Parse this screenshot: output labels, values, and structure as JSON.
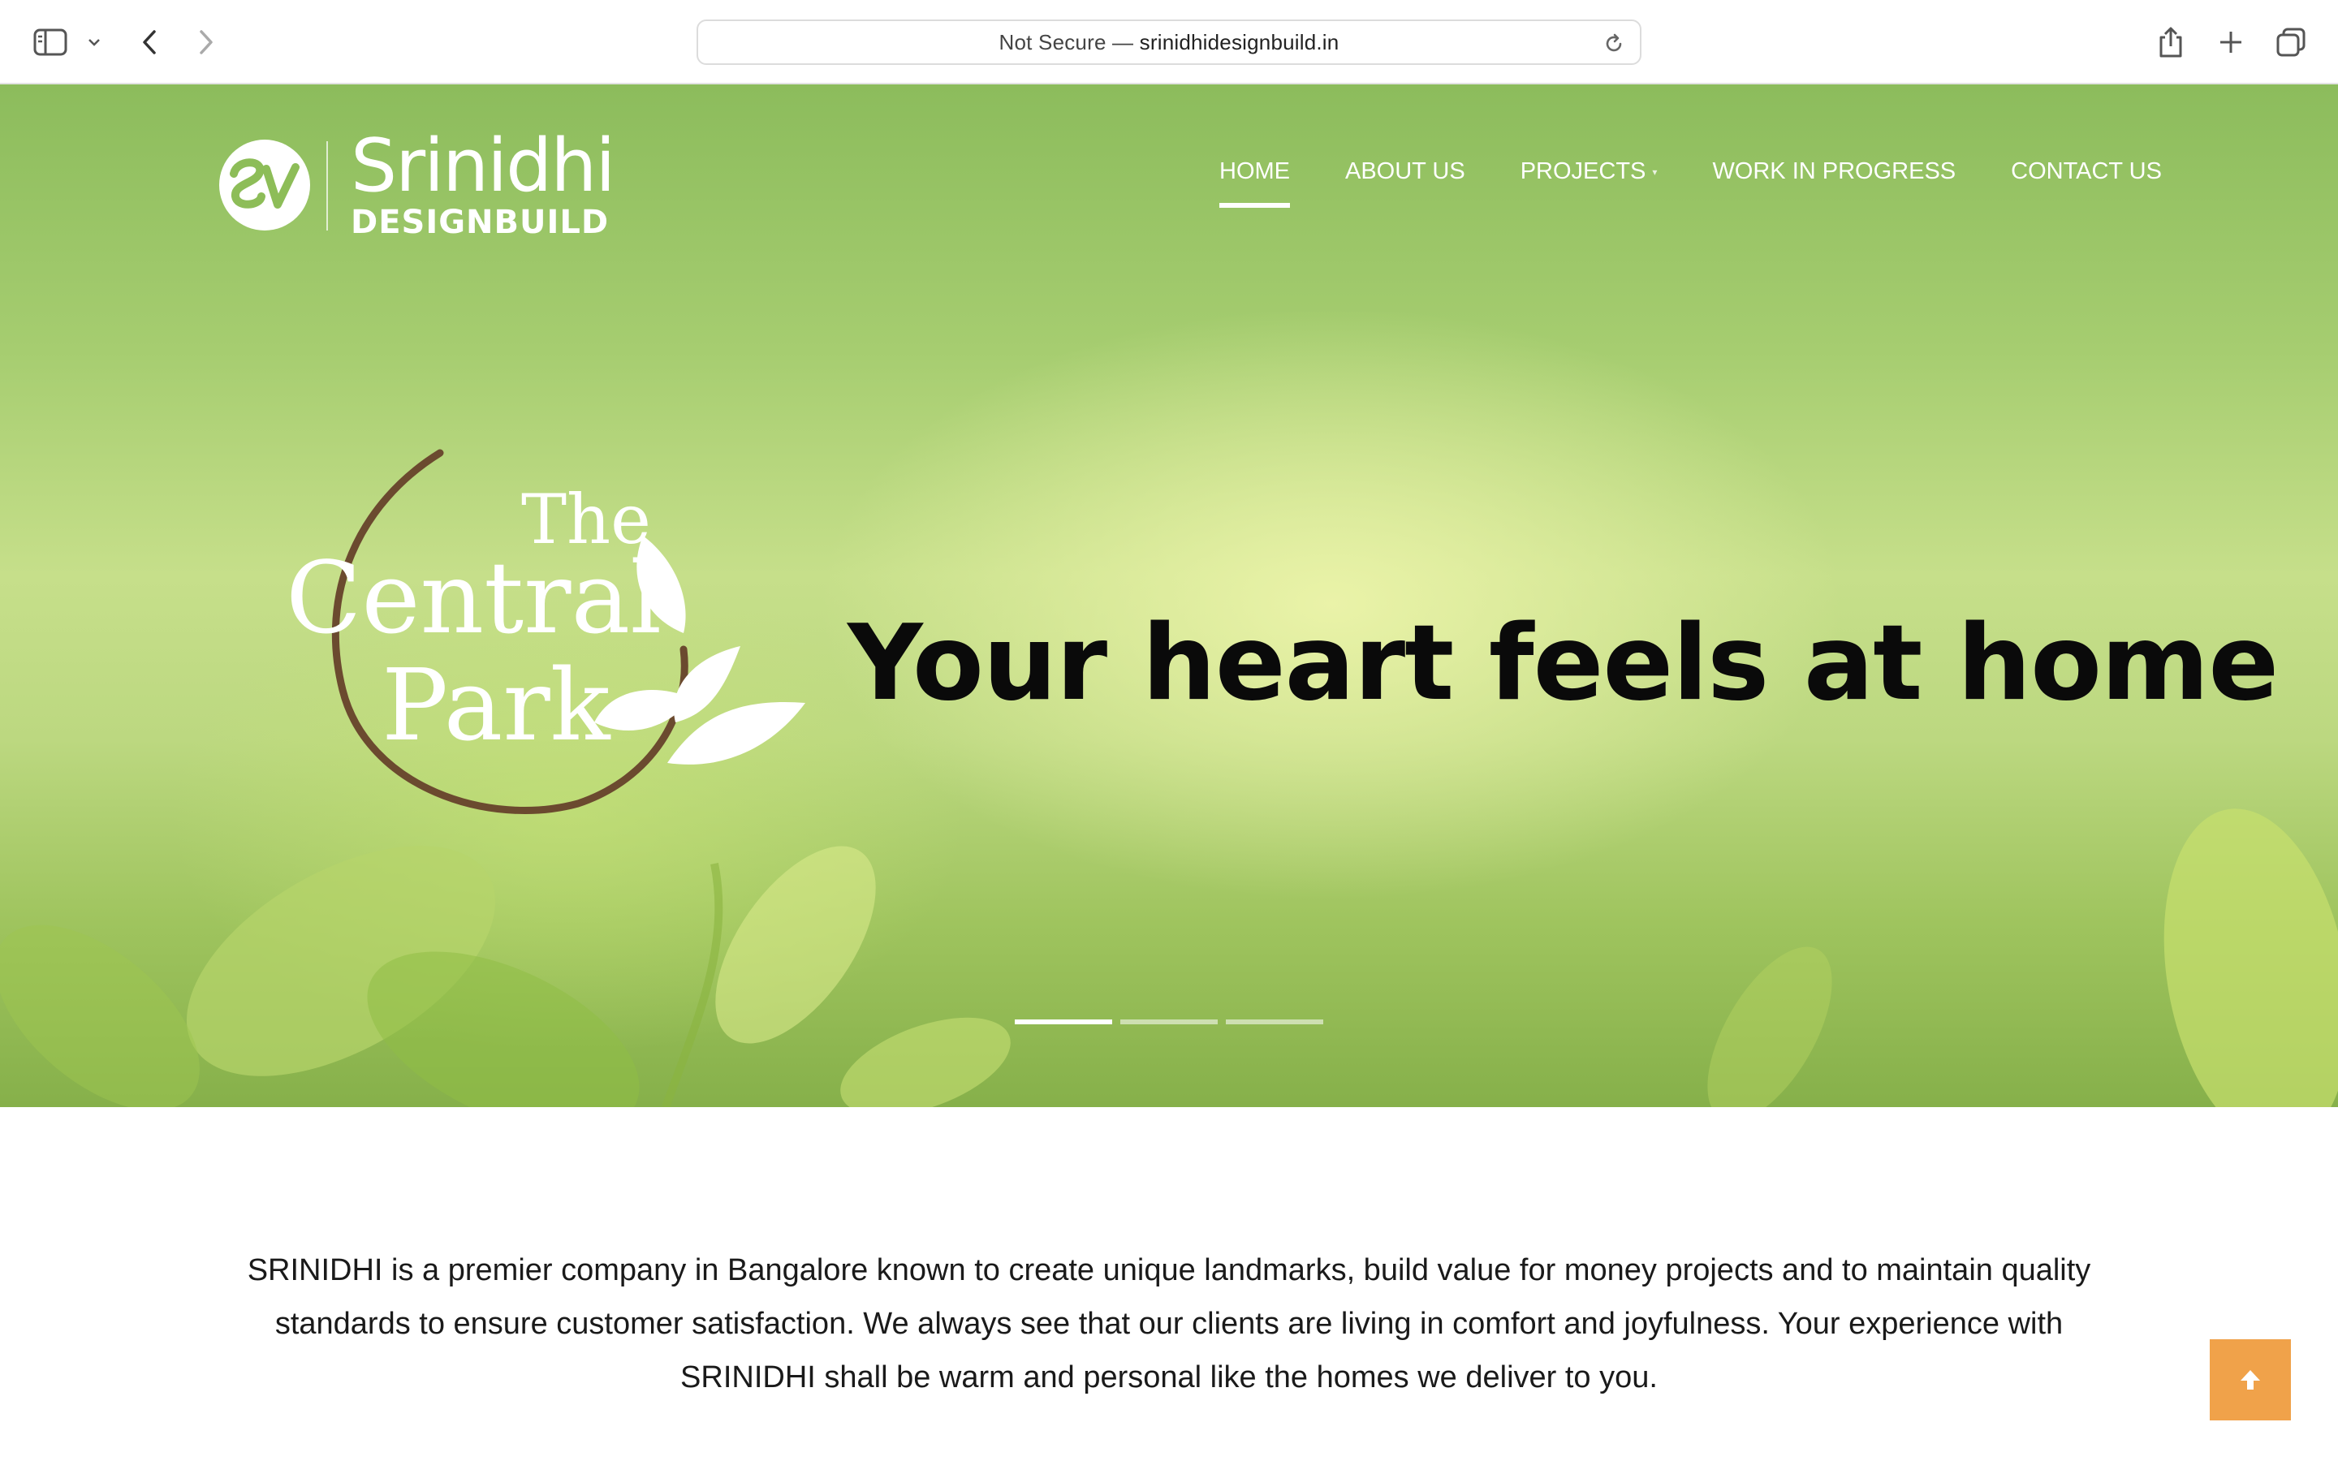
{
  "browser": {
    "address_prefix": "Not Secure — ",
    "address_domain": "srinidhidesignbuild.in",
    "icons": [
      "sidebar-icon",
      "chevron-down-icon",
      "back-icon",
      "forward-icon",
      "reload-icon",
      "share-icon",
      "plus-icon",
      "tabs-icon"
    ]
  },
  "site": {
    "logo": {
      "name": "Srinidhi",
      "sub": "DESIGNBUILD"
    },
    "nav": [
      {
        "label": "HOME",
        "active": true
      },
      {
        "label": "ABOUT US",
        "active": false
      },
      {
        "label": "PROJECTS",
        "active": false,
        "has_dropdown": true
      },
      {
        "label": "WORK IN PROGRESS",
        "active": false
      },
      {
        "label": "CONTACT US",
        "active": false
      }
    ]
  },
  "hero": {
    "project_logo": {
      "line1": "The",
      "line2": "Central",
      "line3": "Park"
    },
    "tagline": "Your heart feels at home",
    "slides": {
      "count": 3,
      "active_index": 0
    }
  },
  "intro": {
    "text": "SRINIDHI is a premier company in Bangalore known to create unique landmarks, build value for money projects and to maintain quality standards to ensure customer satisfaction. We always see that our clients are living in comfort and joyfulness. Your experience with SRINIDHI shall be warm and personal like the homes we deliver to you."
  },
  "colors": {
    "hero_green": "#9fc45e",
    "scroll_top_orange": "#f0a24a",
    "ring_brown": "#6b4a2f"
  }
}
